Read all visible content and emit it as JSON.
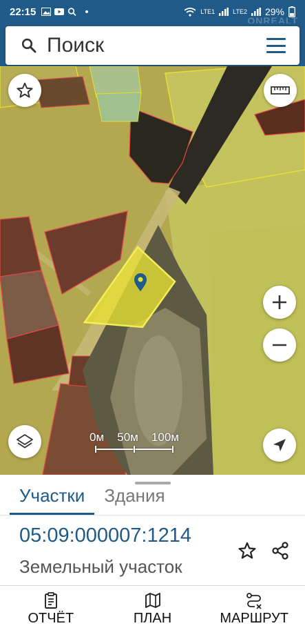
{
  "status_bar": {
    "time": "22:15",
    "notification_dot": "•",
    "network_labels": [
      "LTE1",
      "LTE2"
    ],
    "battery": "29%",
    "icons": [
      "image-icon",
      "youtube-icon",
      "search-icon",
      "wifi-icon",
      "signal-icon",
      "battery-icon"
    ]
  },
  "watermark": "ONREALT",
  "search": {
    "placeholder": "Поиск"
  },
  "map": {
    "scale_labels": [
      "0м",
      "50м",
      "100м"
    ],
    "parcel_color": "#e8e034",
    "boundary_color": "#e04848",
    "buttons": [
      "favorites-star-icon",
      "ruler-icon",
      "zoom-in-icon",
      "zoom-out-icon",
      "layers-icon",
      "locate-arrow-icon"
    ]
  },
  "panel": {
    "tabs": [
      {
        "label": "Участки",
        "active": true
      },
      {
        "label": "Здания",
        "active": false
      }
    ],
    "cadastral_number": "05:09:000007:1214",
    "subtitle": "Земельный участок"
  },
  "bottom_nav": [
    {
      "label": "ОТЧЁТ",
      "icon": "report-icon"
    },
    {
      "label": "ПЛАН",
      "icon": "map-plan-icon"
    },
    {
      "label": "МАРШРУТ",
      "icon": "route-icon"
    }
  ],
  "colors": {
    "accent": "#1f5a88",
    "parcel_fill": "#e8e034"
  }
}
